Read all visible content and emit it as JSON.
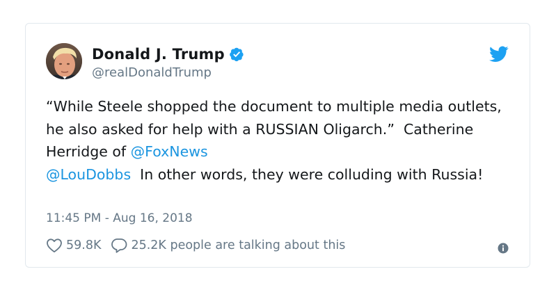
{
  "tweet": {
    "author_name": "Donald J. Trump",
    "author_handle": "@realDonaldTrump",
    "verified": true,
    "text_part1": "“While Steele shopped the document to multiple media outlets, he also asked for help with a RUSSIAN Oligarch.”  Catherine Herridge of ",
    "mention1": "@FoxNews",
    "text_part2": "\n",
    "mention2": "@LouDobbs",
    "text_part3": "  In other words, they were colluding with Russia!",
    "timestamp": "11:45 PM - Aug 16, 2018",
    "likes": "59.8K",
    "talking": "25.2K people are talking about this"
  },
  "icons": {
    "avatar": "author-avatar",
    "verified": "verified-badge-icon",
    "brand": "twitter-bird-icon",
    "like": "heart-icon",
    "reply": "speech-bubble-icon",
    "info": "info-icon"
  },
  "colors": {
    "brand_blue": "#1da1f2",
    "link_blue": "#1b95e0",
    "text": "#14171a",
    "muted": "#657786",
    "border": "#e1e8ed"
  }
}
